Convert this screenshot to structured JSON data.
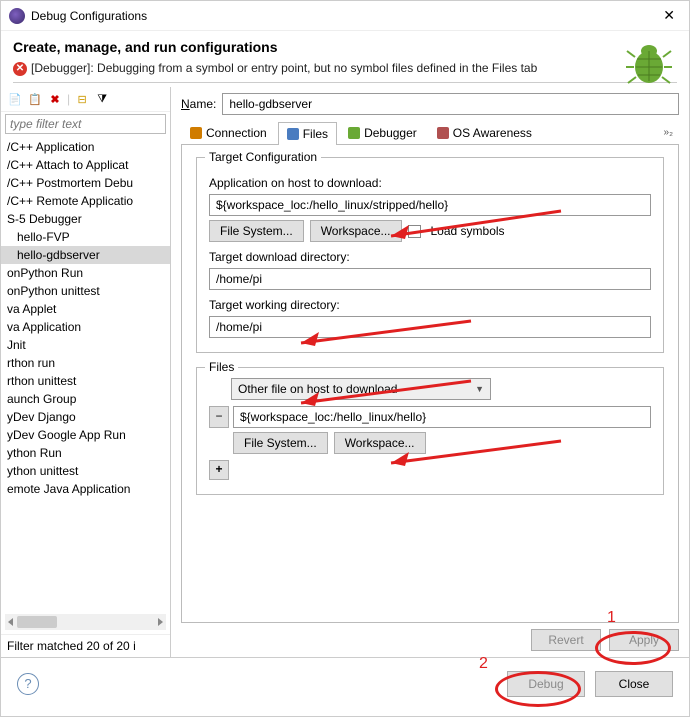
{
  "window": {
    "title": "Debug Configurations"
  },
  "header": {
    "title": "Create, manage, and run configurations",
    "error": "[Debugger]: Debugging from a symbol or entry point, but no symbol files defined in the Files tab"
  },
  "left": {
    "filter_placeholder": "type filter text",
    "items": [
      "/C++ Application",
      "/C++ Attach to Applicat",
      "/C++ Postmortem Debu",
      "/C++ Remote Applicatio",
      "S-5 Debugger",
      "hello-FVP",
      "hello-gdbserver",
      "onPython Run",
      "onPython unittest",
      "va Applet",
      "va Application",
      "Jnit",
      "rthon run",
      "rthon unittest",
      "aunch Group",
      "yDev Django",
      "yDev Google App Run",
      "ython Run",
      "ython unittest",
      "emote Java Application"
    ],
    "selected_index": 6,
    "child_indices": [
      5,
      6
    ],
    "status": "Filter matched 20 of 20 i"
  },
  "right": {
    "name_label": "Name:",
    "name_value": "hello-gdbserver",
    "tabs": [
      "Connection",
      "Files",
      "Debugger",
      "OS Awareness"
    ],
    "active_tab": 1,
    "overflow": "»₂"
  },
  "target": {
    "group_title": "Target Configuration",
    "app_label": "Application on host to download:",
    "app_value": "${workspace_loc:/hello_linux/stripped/hello}",
    "btn_filesystem": "File System...",
    "btn_workspace": "Workspace...",
    "chk_load_symbols": "Load symbols",
    "download_dir_label": "Target download directory:",
    "download_dir_value": "/home/pi",
    "working_dir_label": "Target working directory:",
    "working_dir_value": "/home/pi"
  },
  "files": {
    "group_title": "Files",
    "select_value": "Other file on host to download",
    "row_value": "${workspace_loc:/hello_linux/hello}",
    "btn_filesystem": "File System...",
    "btn_workspace": "Workspace..."
  },
  "actions": {
    "revert": "Revert",
    "apply": "Apply"
  },
  "footer": {
    "debug": "Debug",
    "close": "Close"
  }
}
